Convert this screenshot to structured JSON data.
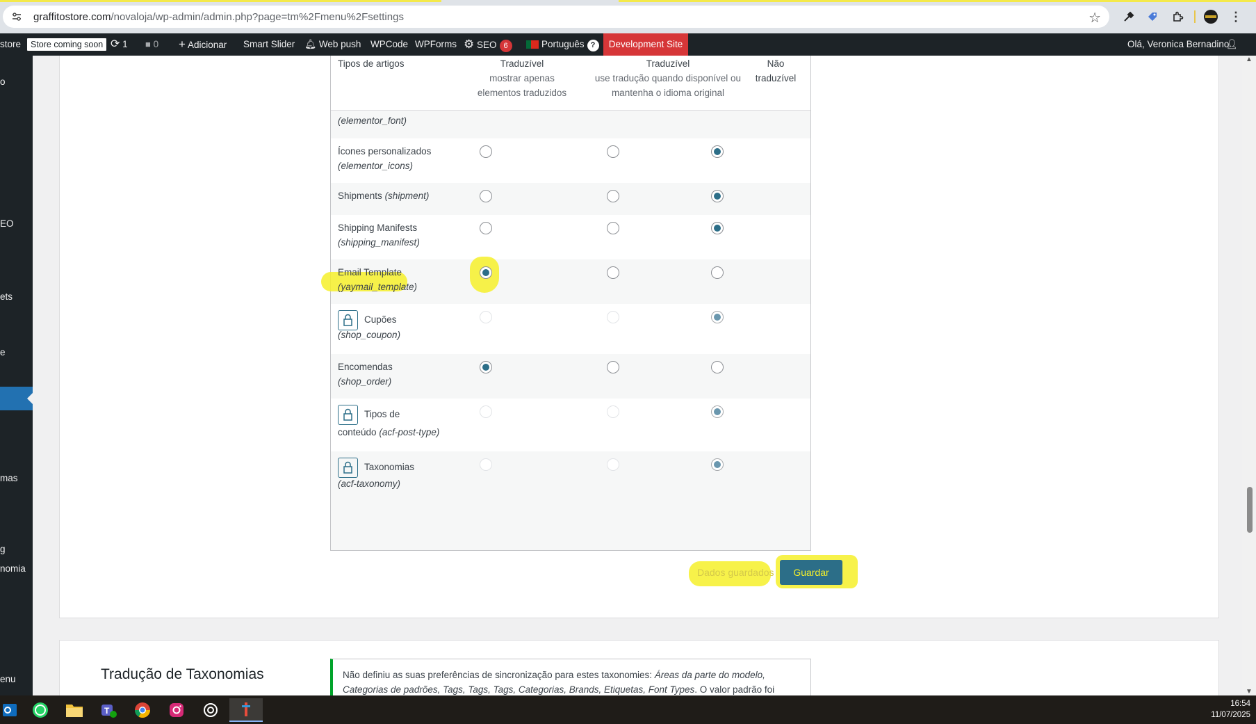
{
  "browser": {
    "url_host": "graffitostore.com",
    "url_path": "/novaloja/wp-admin/admin.php?page=tm%2Fmenu%2Fsettings",
    "icons": [
      "tune-icon",
      "star-icon",
      "eyedropper-icon",
      "tag-extension-icon",
      "extensions-icon",
      "profile-icon",
      "menu-dots-icon"
    ]
  },
  "adminbar": {
    "site_fragment": "store",
    "store_badge": "Store coming soon",
    "updates_count": "1",
    "comments_count": "0",
    "add_new": "Adicionar",
    "smart_slider": "Smart Slider",
    "web_push": "Web push",
    "wpcode": "WPCode",
    "wpforms": "WPForms",
    "seo": "SEO",
    "seo_count": "6",
    "language": "Português",
    "help": "?",
    "dev_site": "Development Site",
    "greeting": "Olá, Veronica Bernadino"
  },
  "leftmenu": {
    "fragments": [
      "o",
      "EO",
      "ets",
      "e",
      "mas",
      "g",
      "nomia",
      "enu"
    ]
  },
  "table": {
    "headers": {
      "col1": "Tipos de artigos",
      "col2_title": "Traduzível",
      "col2_sub1": "mostrar apenas",
      "col2_sub2": "elementos traduzidos",
      "col3_title": "Traduzível",
      "col3_sub1": "use tradução quando disponível ou",
      "col3_sub2": "mantenha o idioma original",
      "col4_line1": "Não",
      "col4_line2": "traduzível"
    },
    "partial_row_slug": "(elementor_font)",
    "rows": [
      {
        "name": "Ícones personalizados",
        "slug": "(elementor_icons)",
        "selected": "nao"
      },
      {
        "name": "Shipments",
        "slug": "(shipment)",
        "selected": "nao"
      },
      {
        "name": "Shipping Manifests",
        "slug": "(shipping_manifest)",
        "selected": "nao"
      },
      {
        "name": "Email Template",
        "slug": "(yaymail_template)",
        "selected": "traduzivel"
      },
      {
        "name": "Cupões",
        "slug": "(shop_coupon)",
        "selected": "nao",
        "locked": true
      },
      {
        "name": "Encomendas",
        "slug": "(shop_order)",
        "selected": "traduzivel"
      },
      {
        "name": "Tipos de",
        "name2": "conteúdo",
        "slug": "(acf-post-type)",
        "selected": "nao",
        "locked": true
      },
      {
        "name": "Taxonomias",
        "slug": "(acf-taxonomy)",
        "selected": "nao",
        "locked": true
      }
    ]
  },
  "actions": {
    "saved_message": "Dados guardados",
    "save_button": "Guardar"
  },
  "taxonomy_section": {
    "title": "Tradução de Taxonomias",
    "notice_prefix": "Não definiu as suas preferências de sincronização para estes taxonomies: ",
    "notice_list_1": "Áreas da parte do modelo,",
    "notice_list_2": "Categorias de padrões, Tags, Tags, Tags, Categorias, Brands, Etiquetas, Font Types",
    "notice_suffix": ". O valor padrão foi"
  },
  "taskbar": {
    "apps": [
      "outlook-icon",
      "whatsapp-icon",
      "file-explorer-icon",
      "teams-icon",
      "chrome-icon",
      "instagram-icon",
      "chatgpt-icon",
      "app-icon"
    ],
    "time": "16:54",
    "date": "11/07/2025"
  }
}
